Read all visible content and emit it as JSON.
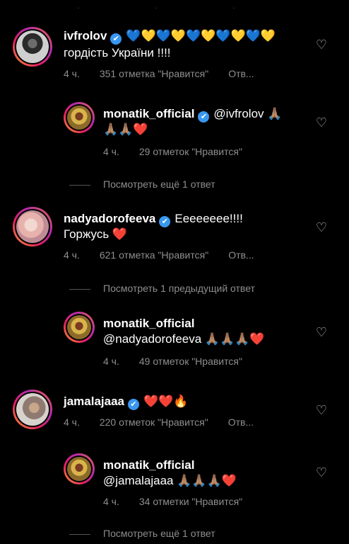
{
  "top_dots": "· · ·",
  "comments": [
    {
      "username": "ivfrolov",
      "text": "💙💛💙💛💙💛💙💛💙💛",
      "text2": "гордість України !!!!",
      "time": "4 ч.",
      "likes": "351 отметка \"Нравится\"",
      "reply": "Отв..."
    },
    {
      "username": "monatik_official",
      "text": "@ivfrolov 🙏🏽",
      "text2": "🙏🏽🙏🏽❤️",
      "time": "4 ч.",
      "likes": "29 отметок \"Нравится\"",
      "view_more": "Посмотреть ещё 1 ответ"
    },
    {
      "username": "nadyadorofeeva",
      "text": "Eeeeeeee!!!!",
      "text2": "Горжусь ❤️",
      "time": "4 ч.",
      "likes": "621 отметка \"Нравится\"",
      "reply": "Отв...",
      "view_more": "Посмотреть 1 предыдущий ответ"
    },
    {
      "username": "monatik_official",
      "text2": "@nadyadorofeeva 🙏🏽🙏🏽🙏🏽❤️",
      "time": "4 ч.",
      "likes": "49 отметок \"Нравится\""
    },
    {
      "username": "jamalajaaa",
      "text": "❤️❤️🔥",
      "time": "4 ч.",
      "likes": "220 отметок \"Нравится\"",
      "reply": "Отв..."
    },
    {
      "username": "monatik_official",
      "text2": "@jamalajaaa 🙏🏽🙏🏽🙏🏽❤️",
      "time": "4 ч.",
      "likes": "34 отметки \"Нравится\"",
      "view_more": "Посмотреть ещё 1 ответ"
    }
  ],
  "icons": {
    "verified": "✔",
    "heart": "♡"
  },
  "colors": {
    "background": "#000000",
    "verified": "#3897f0",
    "meta": "#8e8e8e"
  }
}
